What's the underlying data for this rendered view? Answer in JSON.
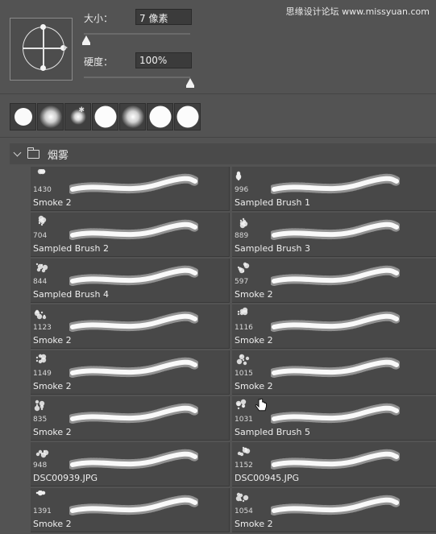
{
  "watermark": "思缘设计论坛 www.missyuan.com",
  "brush_settings": {
    "size_label": "大小：",
    "size_value": "7 像素",
    "size_slider_fraction": 0.02,
    "hardness_label": "硬度：",
    "hardness_value": "100%",
    "hardness_slider_fraction": 1.0
  },
  "presets": [
    "hard-round",
    "soft-round",
    "small-soft-round",
    "hard-round-large",
    "soft-round-large",
    "hard-round-xl",
    "hard-round-xl"
  ],
  "group": {
    "name": "烟雾"
  },
  "brushes": [
    {
      "count": "1430",
      "name": "Smoke 2"
    },
    {
      "count": "996",
      "name": "Sampled Brush 1"
    },
    {
      "count": "704",
      "name": "Sampled Brush 2"
    },
    {
      "count": "889",
      "name": "Sampled Brush 3"
    },
    {
      "count": "844",
      "name": "Sampled Brush 4"
    },
    {
      "count": "597",
      "name": "Smoke 2"
    },
    {
      "count": "1123",
      "name": "Smoke 2"
    },
    {
      "count": "1116",
      "name": "Smoke 2"
    },
    {
      "count": "1149",
      "name": "Smoke 2"
    },
    {
      "count": "1015",
      "name": "Smoke 2"
    },
    {
      "count": "835",
      "name": "Smoke 2"
    },
    {
      "count": "1031",
      "name": "Sampled Brush 5"
    },
    {
      "count": "948",
      "name": "DSC00939.JPG"
    },
    {
      "count": "1152",
      "name": "DSC00945.JPG"
    },
    {
      "count": "1391",
      "name": "Smoke 2"
    },
    {
      "count": "1054",
      "name": "Smoke 2"
    }
  ],
  "colors": {
    "panel": "#535353",
    "cell": "#484848",
    "field": "#3b3b3b"
  }
}
